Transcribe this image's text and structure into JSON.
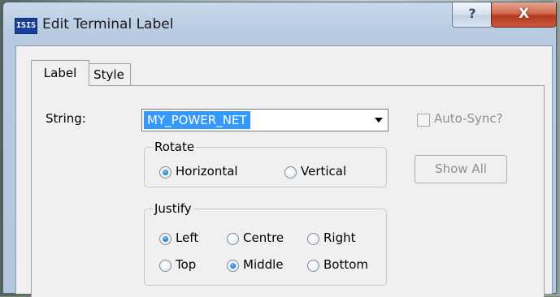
{
  "window": {
    "app_icon": "ISIS",
    "title": "Edit Terminal Label",
    "help_button": "?",
    "close_button": "X"
  },
  "tabs": [
    {
      "label": "Label",
      "selected": true
    },
    {
      "label": "Style",
      "selected": false
    }
  ],
  "string_field": {
    "label": "String:",
    "value": "MY_POWER_NET"
  },
  "auto_sync": {
    "label": "Auto-Sync?",
    "checked": false,
    "enabled": false
  },
  "show_all_button": {
    "label": "Show All",
    "enabled": false
  },
  "rotate": {
    "legend": "Rotate",
    "options": [
      {
        "label": "Horizontal",
        "selected": true
      },
      {
        "label": "Vertical",
        "selected": false
      }
    ]
  },
  "justify": {
    "legend": "Justify",
    "horizontal": [
      {
        "label": "Left",
        "selected": true
      },
      {
        "label": "Centre",
        "selected": false
      },
      {
        "label": "Right",
        "selected": false
      }
    ],
    "vertical": [
      {
        "label": "Top",
        "selected": false
      },
      {
        "label": "Middle",
        "selected": true
      },
      {
        "label": "Bottom",
        "selected": false
      }
    ]
  },
  "colors": {
    "selection_highlight": "#3399ff",
    "close_button": "#c0432a",
    "dialog_background": "#f0f0f0"
  }
}
